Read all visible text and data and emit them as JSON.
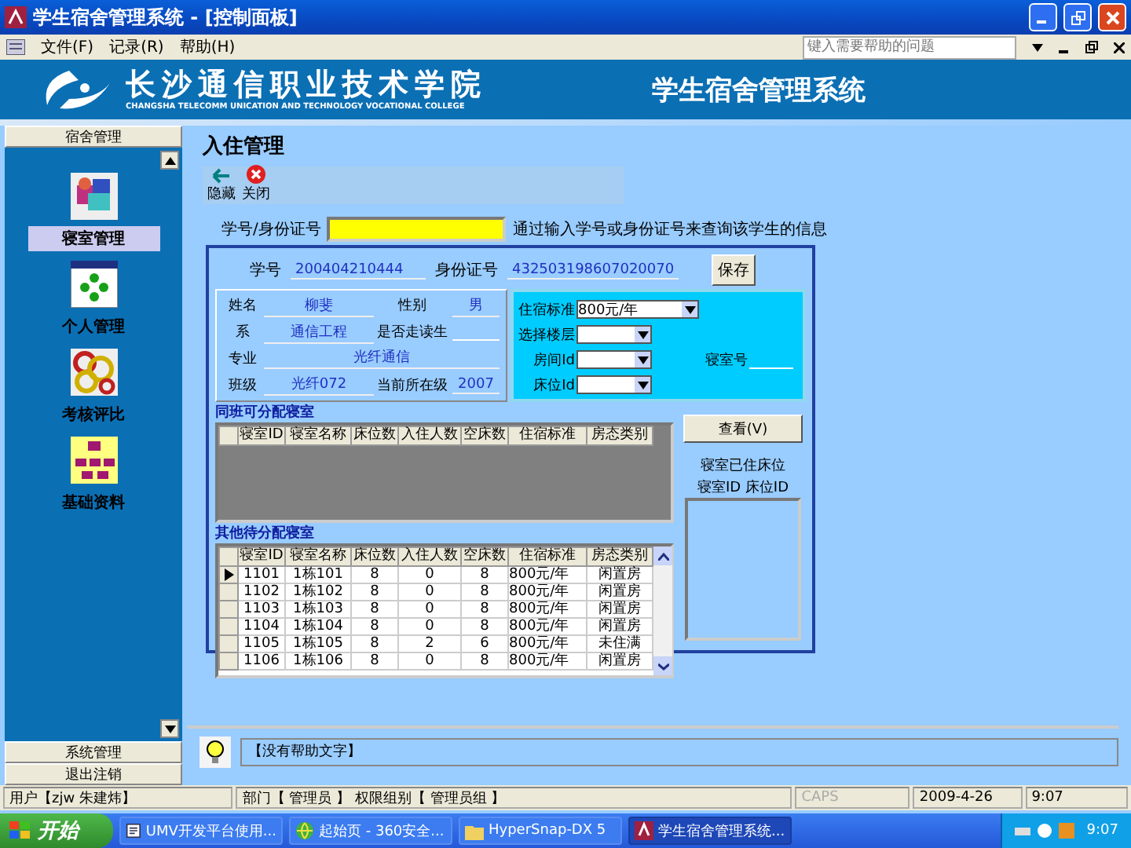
{
  "window": {
    "title": "学生宿舍管理系统 - [控制面板]"
  },
  "menu": {
    "items": [
      "文件(F)",
      "记录(R)",
      "帮助(H)"
    ],
    "help_search": {
      "placeholder": "键入需要帮助的问题"
    }
  },
  "banner": {
    "school_name": "长沙通信职业技术学院",
    "school_name_en": "CHANGSHA TELECOMM UNICATION AND TECHNOLOGY VOCATIONAL COLLEGE",
    "system_title": "学生宿舍管理系统"
  },
  "sidebar": {
    "header": "宿舍管理",
    "items": [
      {
        "label": "寝室管理",
        "kind": "cubes",
        "selected": true
      },
      {
        "label": "个人管理",
        "kind": "dots",
        "selected": false
      },
      {
        "label": "考核评比",
        "kind": "gears",
        "selected": false
      },
      {
        "label": "基础资料",
        "kind": "org",
        "selected": false
      }
    ],
    "footer_buttons": [
      "系统管理",
      "退出注销"
    ]
  },
  "page": {
    "title": "入住管理",
    "toolbar": [
      {
        "label": "隐藏",
        "kind": "back"
      },
      {
        "label": "关闭",
        "kind": "close"
      }
    ]
  },
  "search": {
    "label": "学号/身份证号",
    "hint": "通过输入学号或身份证号来查询该学生的信息"
  },
  "student": {
    "id_label": "学号",
    "id_value": "200404210444",
    "idcard_label": "身份证号",
    "idcard_value": "432503198607020070",
    "save_button": "保存"
  },
  "info": [
    {
      "label": "姓名",
      "value": "柳斐"
    },
    {
      "label": "性别",
      "value": "男"
    },
    {
      "label": "系",
      "value": "通信工程"
    },
    {
      "label": "是否走读生"
    },
    {
      "label": "专业",
      "value": "光纤通信"
    },
    {
      "label": "班级",
      "value": "光纤072"
    },
    {
      "label": "当前所在级",
      "value": "2007"
    }
  ],
  "dorm_select": {
    "fields": [
      {
        "label": "住宿标准",
        "value": "800元/年"
      },
      {
        "label": "选择楼层"
      },
      {
        "label": "房间Id"
      },
      {
        "label": "床位Id"
      }
    ],
    "room_no_label": "寝室号"
  },
  "class_rooms": {
    "title": "同班可分配寝室",
    "columns": [
      "寝室ID",
      "寝室名称",
      "床位数",
      "入住人数",
      "空床数",
      "住宿标准",
      "房态类别"
    ]
  },
  "other_rooms": {
    "title": "其他待分配寝室",
    "columns": [
      "寝室ID",
      "寝室名称",
      "床位数",
      "入住人数",
      "空床数",
      "住宿标准",
      "房态类别"
    ],
    "rows": [
      {
        "cells": [
          "1101",
          "1栋101",
          "8",
          "0",
          "8",
          "800元/年",
          "闲置房"
        ],
        "current": true
      },
      {
        "cells": [
          "1102",
          "1栋102",
          "8",
          "0",
          "8",
          "800元/年",
          "闲置房"
        ],
        "current": false
      },
      {
        "cells": [
          "1103",
          "1栋103",
          "8",
          "0",
          "8",
          "800元/年",
          "闲置房"
        ],
        "current": false
      },
      {
        "cells": [
          "1104",
          "1栋104",
          "8",
          "0",
          "8",
          "800元/年",
          "闲置房"
        ],
        "current": false
      },
      {
        "cells": [
          "1105",
          "1栋105",
          "8",
          "2",
          "6",
          "800元/年",
          "未住满"
        ],
        "current": false
      },
      {
        "cells": [
          "1106",
          "1栋106",
          "8",
          "0",
          "8",
          "800元/年",
          "闲置房"
        ],
        "current": false
      }
    ]
  },
  "occupied": {
    "view_button": "查看(V)",
    "title": "寝室已住床位",
    "columns": "寝室ID 床位ID"
  },
  "help": {
    "text": "【没有帮助文字】"
  },
  "status_bar": {
    "user": "用户【zjw 朱建炜】",
    "dept": "部门【 管理员 】 权限组别【 管理员组 】",
    "caps": "CAPS",
    "caps_on": false,
    "date": "2009-4-26",
    "time": "9:07"
  },
  "taskbar": {
    "start": "开始",
    "tasks": [
      {
        "label": "UMV开发平台使用...",
        "kind": "doc",
        "selected": false
      },
      {
        "label": "起始页 - 360安全...",
        "kind": "globe",
        "selected": false
      },
      {
        "label": "HyperSnap-DX 5",
        "kind": "folder",
        "selected": false
      },
      {
        "label": "学生宿舍管理系统...",
        "kind": "app",
        "selected": true
      }
    ],
    "clock": "9:07"
  }
}
